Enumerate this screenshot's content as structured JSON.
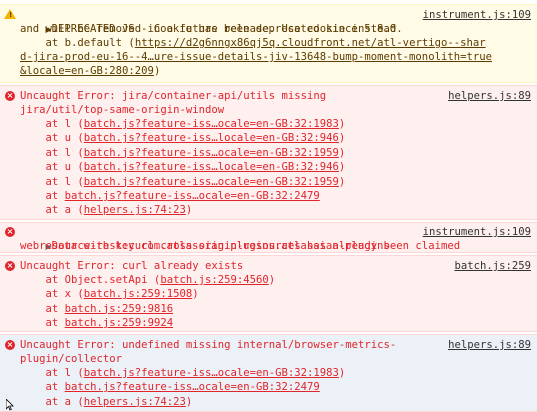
{
  "warning": {
    "caret": "▶",
    "text_1": "DEPRECATED JS - Cookie has been deprecated since 5.8.0 ",
    "source": "instrument.js:109",
    "line_2": "and will be removed in a future release. Use cookie instead.",
    "at_prefix": "    at b.default (",
    "url_1": "https://d2g6nngx86qj5q.cloudfront.net/atl-vertigo--shar",
    "url_2": "d-jira-prod-eu-16--4…ure-issue-details-jiv-13648-bump-moment-monolith=true",
    "url_3": "&locale=en-GB:280:209",
    "close": ")"
  },
  "error1": {
    "line_1": "Uncaught Error: jira/container-api/utils missing",
    "source": "helpers.js:89",
    "line_2": "jira/util/top-same-origin-window",
    "frames": [
      {
        "prefix": "    at l (",
        "link": "batch.js?feature-iss…ocale=en-GB:32:1983",
        "suffix": ")"
      },
      {
        "prefix": "    at u (",
        "link": "batch.js?feature-iss…locale=en-GB:32:946",
        "suffix": ")"
      },
      {
        "prefix": "    at l (",
        "link": "batch.js?feature-iss…ocale=en-GB:32:1959",
        "suffix": ")"
      },
      {
        "prefix": "    at u (",
        "link": "batch.js?feature-iss…locale=en-GB:32:946",
        "suffix": ")"
      },
      {
        "prefix": "    at l (",
        "link": "batch.js?feature-iss…ocale=en-GB:32:1959",
        "suffix": ")"
      },
      {
        "prefix": "    at ",
        "link": "batch.js?feature-iss…ocale=en-GB:32:2479",
        "suffix": ""
      },
      {
        "prefix": "    at a (",
        "link": "helpers.js:74:23",
        "suffix": ")"
      }
    ]
  },
  "error2": {
    "caret": "▶",
    "line_1": "Data with key com.atlassian.plugins.atlassian-plugins-",
    "source": "instrument.js:109",
    "line_2": "webresource-rest:curl.cross-origin-resources has already been claimed"
  },
  "error3": {
    "line_1": "Uncaught Error: curl already exists",
    "source": "batch.js:259",
    "frames": [
      {
        "prefix": "    at Object.setApi (",
        "link": "batch.js:259:4560",
        "suffix": ")"
      },
      {
        "prefix": "    at x (",
        "link": "batch.js:259:1508",
        "suffix": ")"
      },
      {
        "prefix": "    at ",
        "link": "batch.js:259:9816",
        "suffix": ""
      },
      {
        "prefix": "    at ",
        "link": "batch.js:259:9924",
        "suffix": ""
      }
    ]
  },
  "error4": {
    "line_1": "Uncaught Error: undefined missing internal/browser-metrics-",
    "source": "helpers.js:89",
    "line_2": "plugin/collector",
    "frames": [
      {
        "prefix": "    at l (",
        "link": "batch.js?feature-iss…ocale=en-GB:32:1983",
        "suffix": ")"
      },
      {
        "prefix": "    at ",
        "link": "batch.js?feature-iss…ocale=en-GB:32:2479",
        "suffix": ""
      },
      {
        "prefix": "    at a (",
        "link": "helpers.js:74:23",
        "suffix": ")"
      }
    ]
  }
}
